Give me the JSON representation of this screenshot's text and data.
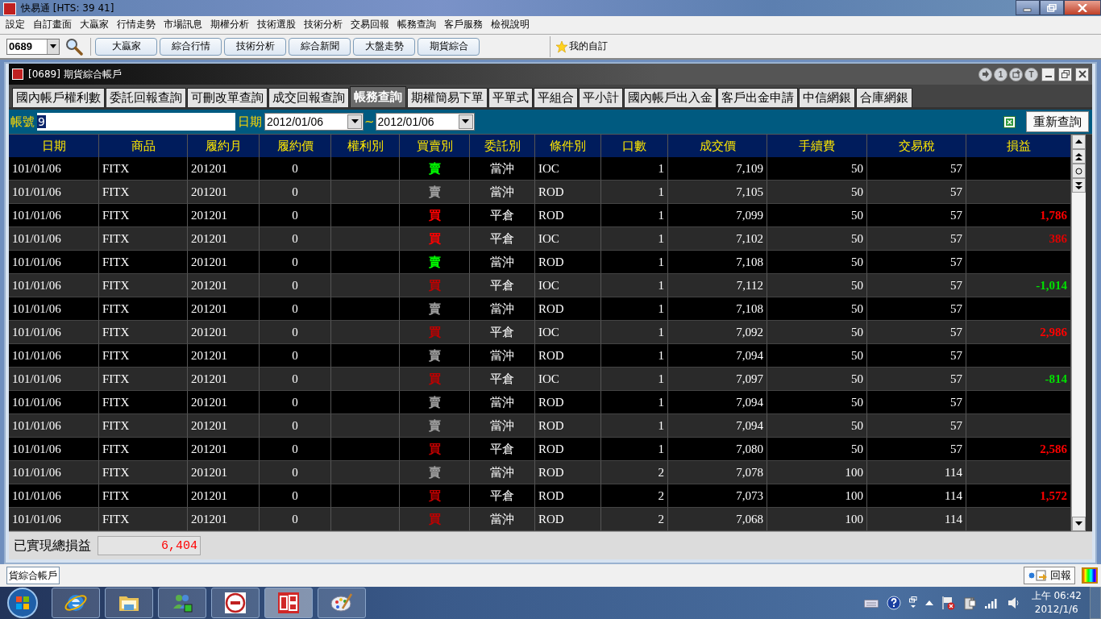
{
  "window": {
    "title": "快易通  [HTS: 39 41]"
  },
  "menu": [
    "設定",
    "自訂畫面",
    "大贏家",
    "行情走勢",
    "市場訊息",
    "期權分析",
    "技術選股",
    "技術分析",
    "交易回報",
    "帳務查詢",
    "客戶服務",
    "檢視說明"
  ],
  "toolbar": {
    "code": "0689",
    "buttons": [
      "大贏家",
      "綜合行情",
      "技術分析",
      "綜合新聞",
      "大盤走勢",
      "期貨綜合"
    ],
    "favorites": "我的自訂"
  },
  "subwindow": {
    "title": "[0689] 期貨綜合帳戶",
    "corner_buttons": [
      "1",
      "T"
    ]
  },
  "tabs": [
    {
      "label": "國內帳戶權利數",
      "selected": false
    },
    {
      "label": "委託回報查詢",
      "selected": false
    },
    {
      "label": "可刪改單查詢",
      "selected": false
    },
    {
      "label": "成交回報查詢",
      "selected": false
    },
    {
      "label": "帳務查詢",
      "selected": true
    },
    {
      "label": "期權簡易下單",
      "selected": false
    },
    {
      "label": "平單式",
      "selected": false
    },
    {
      "label": "平組合",
      "selected": false
    },
    {
      "label": "平小計",
      "selected": false
    },
    {
      "label": "國內帳戶出入金",
      "selected": false
    },
    {
      "label": "客戶出金申請",
      "selected": false
    },
    {
      "label": "中信網銀",
      "selected": false
    },
    {
      "label": "合庫網銀",
      "selected": false
    }
  ],
  "query": {
    "account_label": "帳號",
    "account_value": "9",
    "date_label": "日期",
    "date_from": "2012/01/06",
    "separator": "~",
    "date_to": "2012/01/06",
    "refresh_button": "重新查詢"
  },
  "table": {
    "columns": [
      "日期",
      "商品",
      "履約月",
      "履約價",
      "權利別",
      "買賣別",
      "委託別",
      "條件別",
      "口數",
      "成交價",
      "手續費",
      "交易稅",
      "損益"
    ],
    "rows": [
      {
        "date": "101/01/06",
        "product": "FITX",
        "month": "201201",
        "strike": "0",
        "side": {
          "text": "賣",
          "color": "#00ff00"
        },
        "order": "當沖",
        "cond": "IOC",
        "qty": "1",
        "price": "7,109",
        "fee": "50",
        "tax": "57"
      },
      {
        "date": "101/01/06",
        "product": "FITX",
        "month": "201201",
        "strike": "0",
        "side": {
          "text": "賣",
          "color": "#a0a0a0"
        },
        "order": "當沖",
        "cond": "ROD",
        "qty": "1",
        "price": "7,105",
        "fee": "50",
        "tax": "57"
      },
      {
        "date": "101/01/06",
        "product": "FITX",
        "month": "201201",
        "strike": "0",
        "side": {
          "text": "買",
          "color": "#ff0000"
        },
        "order": "平倉",
        "cond": "ROD",
        "qty": "1",
        "price": "7,099",
        "fee": "50",
        "tax": "57",
        "pnl": {
          "text": "1,786",
          "color": "#ff0000"
        }
      },
      {
        "date": "101/01/06",
        "product": "FITX",
        "month": "201201",
        "strike": "0",
        "side": {
          "text": "買",
          "color": "#ff0000"
        },
        "order": "平倉",
        "cond": "IOC",
        "qty": "1",
        "price": "7,102",
        "fee": "50",
        "tax": "57",
        "pnl": {
          "text": "386",
          "color": "#e00000"
        }
      },
      {
        "date": "101/01/06",
        "product": "FITX",
        "month": "201201",
        "strike": "0",
        "side": {
          "text": "賣",
          "color": "#00ff00"
        },
        "order": "當沖",
        "cond": "ROD",
        "qty": "1",
        "price": "7,108",
        "fee": "50",
        "tax": "57"
      },
      {
        "date": "101/01/06",
        "product": "FITX",
        "month": "201201",
        "strike": "0",
        "side": {
          "text": "買",
          "color": "#c00000"
        },
        "order": "平倉",
        "cond": "IOC",
        "qty": "1",
        "price": "7,112",
        "fee": "50",
        "tax": "57",
        "pnl": {
          "text": "-1,014",
          "color": "#00e000"
        }
      },
      {
        "date": "101/01/06",
        "product": "FITX",
        "month": "201201",
        "strike": "0",
        "side": {
          "text": "賣",
          "color": "#a0a0a0"
        },
        "order": "當沖",
        "cond": "ROD",
        "qty": "1",
        "price": "7,108",
        "fee": "50",
        "tax": "57"
      },
      {
        "date": "101/01/06",
        "product": "FITX",
        "month": "201201",
        "strike": "0",
        "side": {
          "text": "買",
          "color": "#c00000"
        },
        "order": "平倉",
        "cond": "IOC",
        "qty": "1",
        "price": "7,092",
        "fee": "50",
        "tax": "57",
        "pnl": {
          "text": "2,986",
          "color": "#ff0000"
        }
      },
      {
        "date": "101/01/06",
        "product": "FITX",
        "month": "201201",
        "strike": "0",
        "side": {
          "text": "賣",
          "color": "#a0a0a0"
        },
        "order": "當沖",
        "cond": "ROD",
        "qty": "1",
        "price": "7,094",
        "fee": "50",
        "tax": "57"
      },
      {
        "date": "101/01/06",
        "product": "FITX",
        "month": "201201",
        "strike": "0",
        "side": {
          "text": "買",
          "color": "#c00000"
        },
        "order": "平倉",
        "cond": "IOC",
        "qty": "1",
        "price": "7,097",
        "fee": "50",
        "tax": "57",
        "pnl": {
          "text": "-814",
          "color": "#00e000"
        }
      },
      {
        "date": "101/01/06",
        "product": "FITX",
        "month": "201201",
        "strike": "0",
        "side": {
          "text": "賣",
          "color": "#a0a0a0"
        },
        "order": "當沖",
        "cond": "ROD",
        "qty": "1",
        "price": "7,094",
        "fee": "50",
        "tax": "57"
      },
      {
        "date": "101/01/06",
        "product": "FITX",
        "month": "201201",
        "strike": "0",
        "side": {
          "text": "賣",
          "color": "#a0a0a0"
        },
        "order": "當沖",
        "cond": "ROD",
        "qty": "1",
        "price": "7,094",
        "fee": "50",
        "tax": "57"
      },
      {
        "date": "101/01/06",
        "product": "FITX",
        "month": "201201",
        "strike": "0",
        "side": {
          "text": "買",
          "color": "#c00000"
        },
        "order": "平倉",
        "cond": "ROD",
        "qty": "1",
        "price": "7,080",
        "fee": "50",
        "tax": "57",
        "pnl": {
          "text": "2,586",
          "color": "#ff0000"
        }
      },
      {
        "date": "101/01/06",
        "product": "FITX",
        "month": "201201",
        "strike": "0",
        "side": {
          "text": "賣",
          "color": "#a0a0a0"
        },
        "order": "當沖",
        "cond": "ROD",
        "qty": "2",
        "price": "7,078",
        "fee": "100",
        "tax": "114"
      },
      {
        "date": "101/01/06",
        "product": "FITX",
        "month": "201201",
        "strike": "0",
        "side": {
          "text": "買",
          "color": "#c00000"
        },
        "order": "平倉",
        "cond": "ROD",
        "qty": "2",
        "price": "7,073",
        "fee": "100",
        "tax": "114",
        "pnl": {
          "text": "1,572",
          "color": "#ff0000"
        }
      },
      {
        "date": "101/01/06",
        "product": "FITX",
        "month": "201201",
        "strike": "0",
        "side": {
          "text": "買",
          "color": "#c00000"
        },
        "order": "當沖",
        "cond": "ROD",
        "qty": "2",
        "price": "7,068",
        "fee": "100",
        "tax": "114"
      }
    ]
  },
  "summary": {
    "label": "已實現總損益",
    "value": "6,404"
  },
  "window_tabs": [
    "貨綜合帳戶"
  ],
  "status": {
    "report_button": "回報"
  },
  "taskbar": {
    "time": "上午 06:42",
    "date": "2012/1/6"
  }
}
